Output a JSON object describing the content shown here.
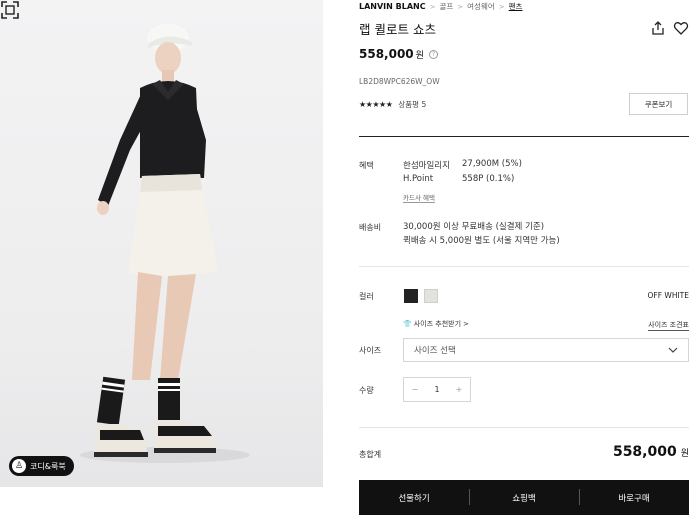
{
  "image": {
    "coordi_label": "코디&룩북",
    "coordi_icon": "hanger-icon",
    "zoom_icon": "expand-icon"
  },
  "breadcrumb": {
    "brand": "LANVIN BLANC",
    "items": [
      "골프",
      "여성웨어",
      "팬츠"
    ]
  },
  "product": {
    "title": "랩 퀼로트 쇼츠",
    "price": "558,000",
    "price_unit": "원",
    "price_help_icon": "question-icon",
    "sku": "LB2D8WPC626W_OW",
    "stars": "★★★★★",
    "rating_text": "상품평 5",
    "coupon_label": "쿠폰보기"
  },
  "benefits": {
    "label": "혜택",
    "items": [
      {
        "name": "한섬마일리지",
        "value": "27,900M (5%)"
      },
      {
        "name": "H.Point",
        "value": "558P (0.1%)"
      }
    ],
    "card_link": "카드사 혜택"
  },
  "shipping": {
    "label": "배송비",
    "line1": "30,000원 이상 무료배송 (실결제 기준)",
    "line2": "퀵배송 시 5,000원 별도 (서울 지역만 가능)"
  },
  "color": {
    "label": "컬러",
    "swatches": [
      "#222222",
      "#e4e2dc"
    ],
    "selected_name": "OFF WHITE"
  },
  "size": {
    "recommend_label": "사이즈 추천받기",
    "guide_label": "사이즈 조견표",
    "label": "사이즈",
    "select_placeholder": "사이즈 선택"
  },
  "quantity": {
    "label": "수량",
    "minus": "−",
    "value": "1",
    "plus": "+"
  },
  "total": {
    "label": "총합계",
    "price": "558,000",
    "unit": "원"
  },
  "actions": {
    "gift": "선물하기",
    "cart": "쇼핑백",
    "buy": "바로구매"
  }
}
